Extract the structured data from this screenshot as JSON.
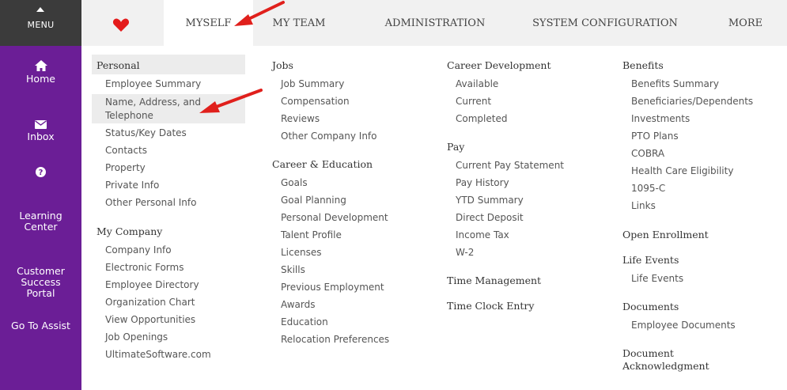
{
  "menu": {
    "label": "MENU"
  },
  "tabs": [
    {
      "label": "MYSELF"
    },
    {
      "label": "MY TEAM"
    },
    {
      "label": "ADMINISTRATION"
    },
    {
      "label": "SYSTEM CONFIGURATION"
    },
    {
      "label": "MORE"
    }
  ],
  "colors": {
    "sidebar": "#6b1e96",
    "heart": "#e41b1b",
    "arrow": "#e0201c"
  },
  "sidebar": [
    {
      "label": "Home",
      "icon": "home-icon"
    },
    {
      "label": "Inbox",
      "icon": "envelope-icon"
    },
    {
      "label": "Learning\nCenter",
      "icon": "question-icon"
    },
    {
      "label": "Customer\nSuccess\nPortal",
      "icon": ""
    },
    {
      "label": "Go To Assist",
      "icon": ""
    }
  ],
  "col1": {
    "personal_header": "Personal",
    "personal": [
      "Employee Summary",
      "Name, Address, and",
      "Telephone",
      "Status/Key Dates",
      "Contacts",
      "Property",
      "Private Info",
      "Other Personal Info"
    ],
    "company_header": "My Company",
    "company": [
      "Company Info",
      "Electronic Forms",
      "Employee Directory",
      "Organization Chart",
      "View Opportunities",
      "Job Openings",
      "UltimateSoftware.com"
    ]
  },
  "col2": {
    "jobs_header": "Jobs",
    "jobs": [
      "Job Summary",
      "Compensation",
      "Reviews",
      "Other Company Info"
    ],
    "career_header": "Career & Education",
    "career": [
      "Goals",
      "Goal Planning",
      "Personal Development",
      "Talent Profile",
      "Licenses",
      "Skills",
      "Previous Employment",
      "Awards",
      "Education",
      "Relocation Preferences"
    ]
  },
  "col3": {
    "cd_header": "Career Development",
    "cd": [
      "Available",
      "Current",
      "Completed"
    ],
    "pay_header": "Pay",
    "pay": [
      "Current Pay Statement",
      "Pay History",
      "YTD Summary",
      "Direct Deposit",
      "Income Tax",
      "W-2"
    ],
    "tm_header": "Time Management",
    "tce_header": "Time Clock Entry"
  },
  "col4": {
    "benefits_header": "Benefits",
    "benefits": [
      "Benefits Summary",
      "Beneficiaries/Dependents",
      "Investments",
      "PTO Plans",
      "COBRA",
      "Health Care Eligibility",
      "1095-C",
      "Links"
    ],
    "oe_header": "Open Enrollment",
    "le_header": "Life Events",
    "le": [
      "Life Events"
    ],
    "docs_header": "Documents",
    "docs": [
      "Employee Documents"
    ],
    "da_header_1": "Document",
    "da_header_2": "Acknowledgment"
  }
}
